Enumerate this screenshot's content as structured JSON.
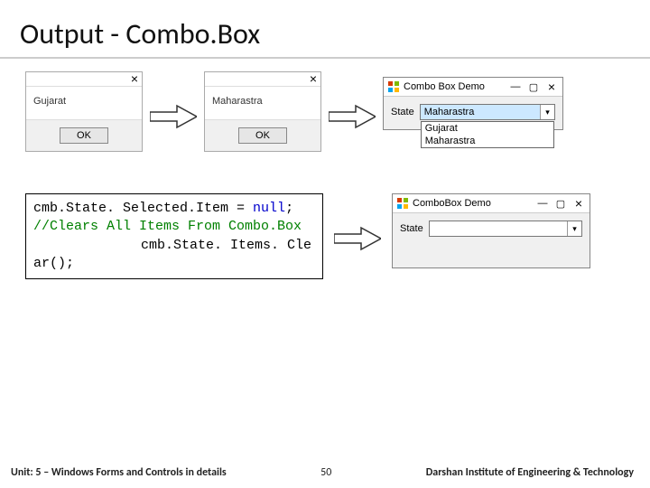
{
  "title": "Output - Combo.Box",
  "msgbox1": {
    "text": "Gujarat",
    "ok": "OK"
  },
  "msgbox2": {
    "text": "Maharastra",
    "ok": "OK"
  },
  "form1": {
    "title": "Combo Box Demo",
    "label": "State",
    "selected": "Maharastra",
    "opt1": "Gujarat",
    "opt2": "Maharastra"
  },
  "code": {
    "l1a": "cmb.State. Selected.Item = ",
    "l1b": "null",
    "l1c": ";",
    "l2": "//Clears All Items From Combo.Box",
    "l3": "cmb.State. Items. Cle",
    "l4": "ar();"
  },
  "form2": {
    "title": "ComboBox Demo",
    "label": "State",
    "selected": ""
  },
  "footer": {
    "unit": "Unit: 5 – Windows Forms and Controls in details",
    "page": "50",
    "inst": "Darshan Institute of Engineering & Technology"
  },
  "glyph": {
    "close": "×",
    "min": "—",
    "max": "▢",
    "down": "▾"
  }
}
